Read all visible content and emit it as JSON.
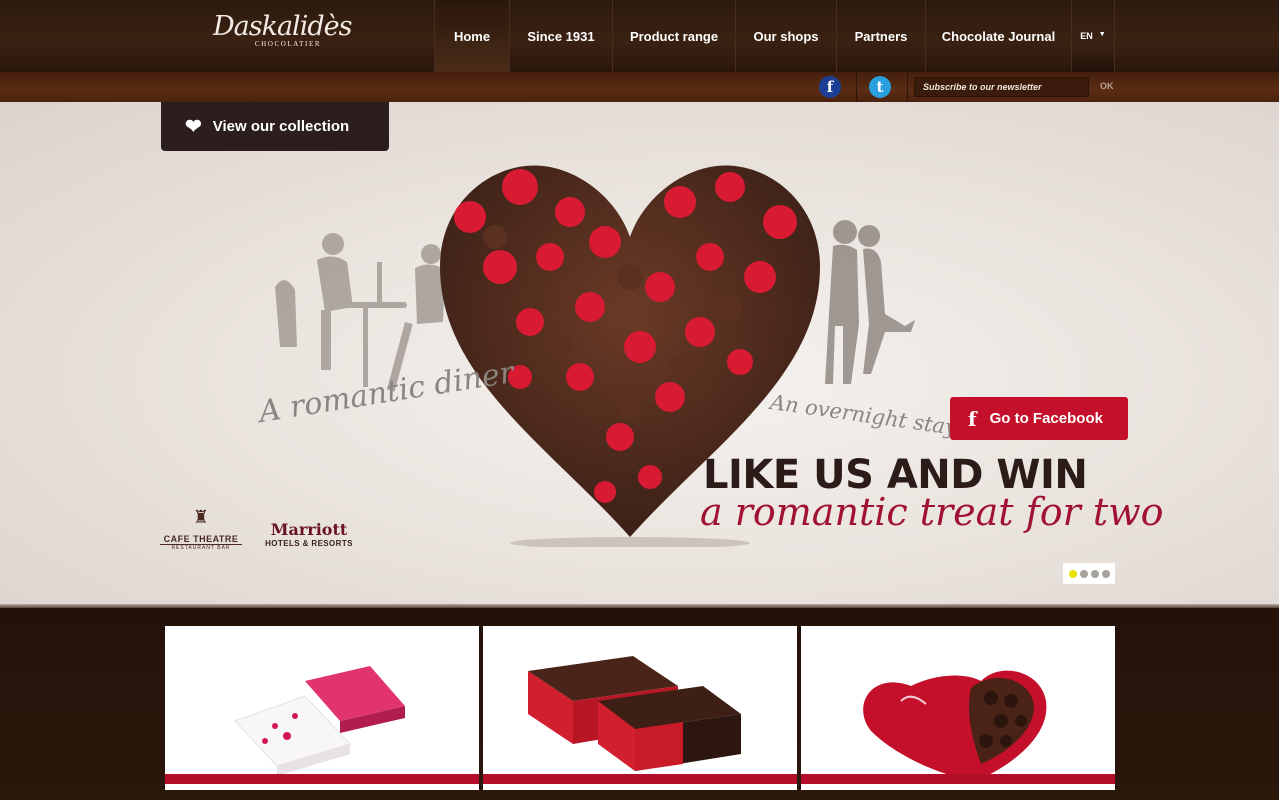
{
  "header": {
    "logo_text": "Daskalidès",
    "logo_sub": "CHOCOLATIER",
    "nav": [
      {
        "label": "Home",
        "active": true
      },
      {
        "label": "Since 1931"
      },
      {
        "label": "Product range"
      },
      {
        "label": "Our shops"
      },
      {
        "label": "Partners"
      },
      {
        "label": "Chocolate Journal"
      }
    ],
    "language": "EN"
  },
  "subbar": {
    "facebook_icon": "facebook-icon",
    "twitter_icon": "twitter-icon",
    "newsletter_placeholder": "Subscribe to our newsletter",
    "ok_label": "OK"
  },
  "hero": {
    "collection_button": "View our collection",
    "romantic_diner": "A romantic diner",
    "overnight_stay": "An overnight stay",
    "facebook_button": "Go to Facebook",
    "headline": "LIKE US AND WIN",
    "subheadline": "a romantic treat for two",
    "partner_cafe": "CAFE THEATRE",
    "partner_cafe_sub": "RESTAURANT BAR",
    "partner_marriott": "Marriott",
    "partner_marriott_sub": "HOTELS & RESORTS",
    "slides": 4,
    "active_slide": 1
  },
  "colors": {
    "accent_red": "#c4102a",
    "dark_brown": "#2b1e1c",
    "header_brown": "#3a2213"
  },
  "products": [
    {
      "name": "white-pink-gift-box"
    },
    {
      "name": "red-brown-ballotin-boxes"
    },
    {
      "name": "heart-shaped-chocolate-box"
    }
  ]
}
